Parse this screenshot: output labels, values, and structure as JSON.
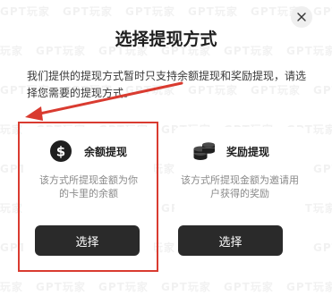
{
  "dialog": {
    "title": "选择提现方式",
    "description": "我们提供的提现方式暂时只支持余额提现和奖励提现，请选择您需要的提现方式。",
    "close_icon": "close-icon"
  },
  "watermark": {
    "text": "GPT玩家"
  },
  "options": [
    {
      "icon": "dollar-coin-icon",
      "name": "余额提现",
      "description": "该方式所提现金额为你的卡里的余额",
      "button_label": "选择",
      "highlighted": true
    },
    {
      "icon": "coin-stack-icon",
      "name": "奖励提现",
      "description": "该方式所提现金额为邀请用户获得的奖励",
      "button_label": "选择",
      "highlighted": false
    }
  ],
  "annotation": {
    "highlight_color": "#d93b30",
    "arrow_color": "#d93b30"
  }
}
